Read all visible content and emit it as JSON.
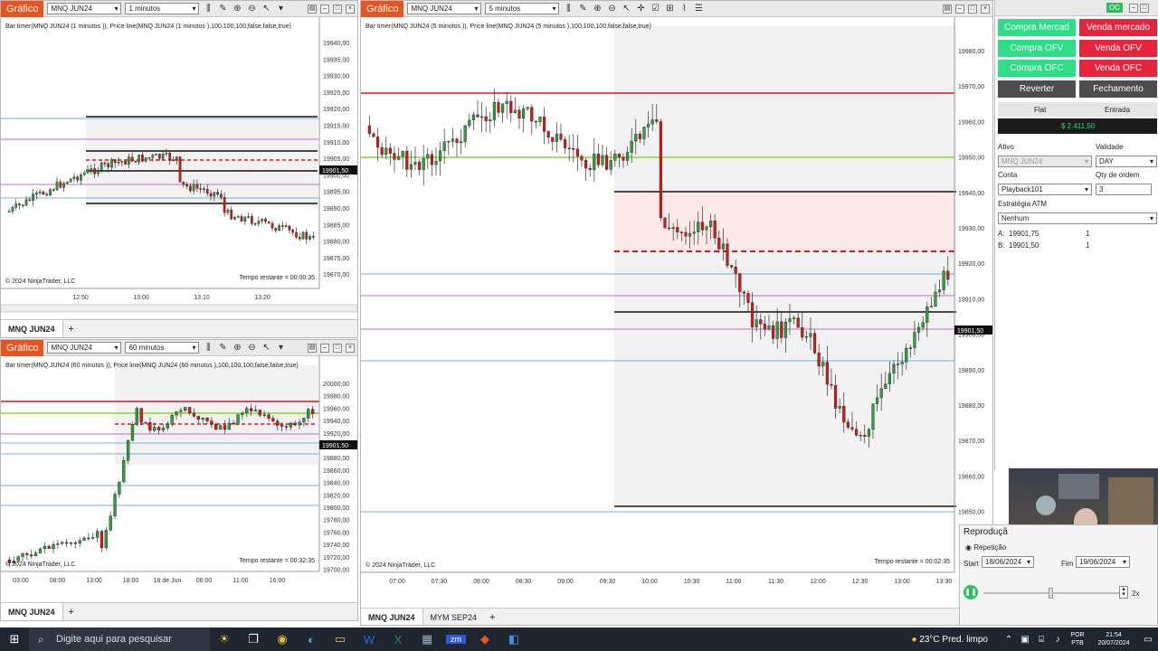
{
  "win1": {
    "label": "Gráfico",
    "instrument": "MNQ JUN24",
    "interval": "1 minutos",
    "header": "Bar timer(MNQ JUN24 (1 minutos )), Price line(MNQ JUN24 (1 minutos ),100,100,100,false,false,true)",
    "copyright": "© 2024 NinjaTrader, LLC",
    "timer": "Tempo restante = 00:00:35",
    "price_tag": "19901,50",
    "yticks": [
      "19940,00",
      "19935,00",
      "19930,00",
      "19925,00",
      "19920,00",
      "19915,00",
      "19910,00",
      "19905,00",
      "19900,00",
      "19895,00",
      "19890,00",
      "19885,00",
      "19880,00",
      "19875,00",
      "19870,00"
    ],
    "xticks": [
      "12:50",
      "13:00",
      "13:10",
      "13:20"
    ],
    "tab": "MNQ JUN24"
  },
  "win2": {
    "label": "Gráfico",
    "instrument": "MNQ JUN24",
    "interval": "60 minutos",
    "header": "Bar timer(MNQ JUN24 (60 minutos )), Price line(MNQ JUN24 (60 minutos ),100,100,100,false,false,true)",
    "copyright": "© 2024 NinjaTrader, LLC",
    "timer": "Tempo restante = 00:32:35",
    "price_tag": "19901,50",
    "yticks": [
      "20000,00",
      "19980,00",
      "19960,00",
      "19940,00",
      "19920,00",
      "19900,00",
      "19880,00",
      "19860,00",
      "19840,00",
      "19820,00",
      "19800,00",
      "19780,00",
      "19760,00",
      "19740,00",
      "19720,00",
      "19700,00"
    ],
    "xticks": [
      "03:00",
      "08:00",
      "13:00",
      "18:00",
      "18 de Jun",
      "06:00",
      "11:00",
      "16:00"
    ],
    "tab": "MNQ JUN24"
  },
  "win3": {
    "label": "Gráfico",
    "instrument": "MNQ JUN24",
    "interval": "5 minutos",
    "header": "Bar timer(MNQ JUN24 (5 minutos )), Price line(MNQ JUN24 (5 minutos ),100,100,100,false,false,true)",
    "copyright": "© 2024 NinjaTrader, LLC",
    "timer": "Tempo restante = 00:02:35",
    "price_tag": "19901,50",
    "yticks": [
      "19980,00",
      "19970,00",
      "19960,00",
      "19950,00",
      "19940,00",
      "19930,00",
      "19920,00",
      "19910,00",
      "19900,00",
      "19890,00",
      "19880,00",
      "19870,00",
      "19860,00",
      "19850,00"
    ],
    "xticks": [
      "07:00",
      "07:30",
      "08:00",
      "08:30",
      "09:00",
      "09:30",
      "10:00",
      "10:30",
      "11:00",
      "11:30",
      "12:00",
      "12:30",
      "13:00",
      "13:30"
    ],
    "tabs": [
      "MNQ JUN24",
      "MYM SEP24"
    ]
  },
  "order_panel": {
    "status": "OC",
    "buttons": {
      "buy_market": "Compra Mercad",
      "sell_market": "Venda mercado",
      "buy_ofv": "Compra OFV",
      "sell_ofv": "Venda OFV",
      "buy_ofc": "Compra OFC",
      "sell_ofc": "Venda OFC",
      "reverse": "Reverter",
      "close": "Fechamento"
    },
    "position": "Flat",
    "entry": "Entrada",
    "pnl": "$ 2.411,50",
    "asset_label": "Ativo",
    "asset": "MNQ JUN24",
    "validity_label": "Validade",
    "validity": "DAY",
    "account_label": "Conta",
    "account": "Playback101",
    "qty_label": "Qty de ordem",
    "qty": "3",
    "atm_label": "Estratégia ATM",
    "atm": "Nenhum",
    "ask_label": "A:",
    "ask": "19901,75",
    "ask_qty": "1",
    "bid_label": "B:",
    "bid": "19901,50",
    "bid_qty": "1"
  },
  "playback": {
    "title": "Reproduçã",
    "repeat": "Repetição",
    "start_label": "Start",
    "start": "18/06/2024",
    "end_label": "Fim",
    "end": "19/06/2024",
    "speed": "2x"
  },
  "taskbar": {
    "search": "Digite aqui para pesquisar",
    "weather": "23°C  Pred. limpo",
    "lang": "POR",
    "layout": "PTB",
    "time": "21:54",
    "date": "20/07/2024"
  },
  "colors": {
    "up": "#2e9e3e",
    "down": "#d01b1b",
    "accent": "#e8531f"
  }
}
